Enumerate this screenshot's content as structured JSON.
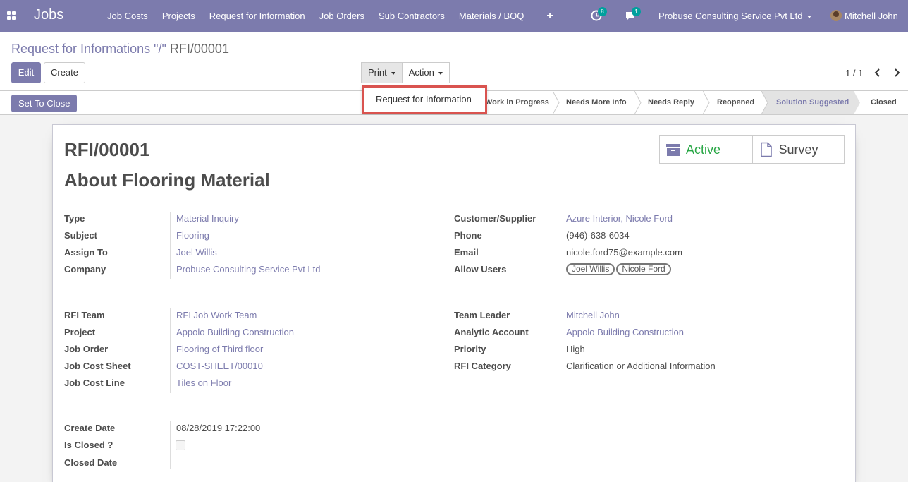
{
  "navbar": {
    "app_title": "Jobs",
    "menu": [
      "Job Costs",
      "Projects",
      "Request for Information",
      "Job Orders",
      "Sub Contractors",
      "Materials / BOQ"
    ],
    "plus": "+",
    "activity_count": "8",
    "message_count": "1",
    "company": "Probuse Consulting Service Pvt Ltd",
    "user": "Mitchell John"
  },
  "control": {
    "breadcrumb_parent": "Request for Informations \"/\"",
    "breadcrumb_current": "RFI/00001",
    "edit_label": "Edit",
    "create_label": "Create",
    "print_label": "Print",
    "action_label": "Action",
    "pager": "1 / 1",
    "print_menu_item": "Request for Information"
  },
  "statusbar": {
    "set_to_close_label": "Set To Close",
    "stages": [
      "Work in Progress",
      "Needs More Info",
      "Needs Reply",
      "Reopened",
      "Solution Suggested",
      "Closed"
    ],
    "current_stage": "Solution Suggested"
  },
  "sheet": {
    "ref": "RFI/00001",
    "subject_title": "About Flooring Material",
    "smart_buttons": {
      "active_label": "Active",
      "survey_label": "Survey"
    },
    "active_color": "#28a745",
    "left_group1": [
      {
        "label": "Type",
        "value": "Material Inquiry"
      },
      {
        "label": "Subject",
        "value": "Flooring"
      },
      {
        "label": "Assign To",
        "value": "Joel Willis"
      },
      {
        "label": "Company",
        "value": "Probuse Consulting Service Pvt Ltd"
      }
    ],
    "right_group1": [
      {
        "label": "Customer/Supplier",
        "value": "Azure Interior, Nicole Ford"
      },
      {
        "label": "Phone",
        "value": "(946)-638-6034"
      },
      {
        "label": "Email",
        "value": "nicole.ford75@example.com"
      },
      {
        "label": "Allow Users",
        "tags": [
          "Joel Willis",
          "Nicole Ford"
        ]
      }
    ],
    "left_group2": [
      {
        "label": "RFI Team",
        "value": "RFI Job Work Team"
      },
      {
        "label": "Project",
        "value": "Appolo Building Construction"
      },
      {
        "label": "Job Order",
        "value": "Flooring of Third floor"
      },
      {
        "label": "Job Cost Sheet",
        "value": "COST-SHEET/00010"
      },
      {
        "label": "Job Cost Line",
        "value": "Tiles on Floor"
      }
    ],
    "right_group2": [
      {
        "label": "Team Leader",
        "value": "Mitchell John"
      },
      {
        "label": "Analytic Account",
        "value": "Appolo Building Construction"
      },
      {
        "label": "Priority",
        "value": "High"
      },
      {
        "label": "RFI Category",
        "value": "Clarification or Additional Information"
      }
    ],
    "left_group3": [
      {
        "label": "Create Date",
        "value": "08/28/2019 17:22:00"
      },
      {
        "label": "Is Closed ?",
        "value": ""
      },
      {
        "label": "Closed Date",
        "value": ""
      }
    ],
    "is_closed": false
  }
}
